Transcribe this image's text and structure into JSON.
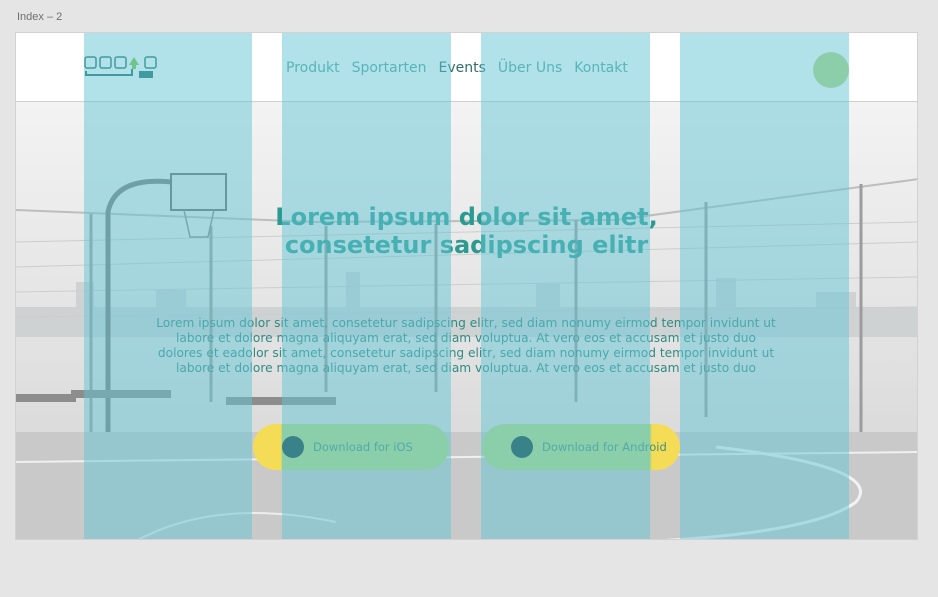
{
  "frame": {
    "label": "Index – 2"
  },
  "logo": {
    "text_main": "SQUAD",
    "text_sub": "UP"
  },
  "nav": {
    "links": [
      "Produkt",
      "Sportarten",
      "Events",
      "Über Uns",
      "Kontakt"
    ]
  },
  "hero": {
    "headline_line1": "Lorem ipsum dolor sit amet,",
    "headline_line2": "consetetur sadipscing elitr",
    "body": "Lorem ipsum dolor sit amet, consetetur sadipscing elitr, sed diam nonumy eirmod tempor invidunt ut labore et dolore magna aliquyam erat, sed diam voluptua. At vero eos et accusam et justo duo dolores et eadolor sit amet, consetetur sadipscing elitr, sed diam nonumy eirmod tempor invidunt ut labore et dolore magna aliquyam erat, sed diam voluptua. At vero eos et accusam et justo duo"
  },
  "cta": {
    "ios_label": "Download for iOS",
    "android_label": "Download for Android"
  },
  "colors": {
    "accent": "#2b9a91",
    "column_overlay": "#64c6d6",
    "button_green": "#b3d67e",
    "button_yellow": "#f4dc57",
    "dot": "#0e3f3d"
  }
}
